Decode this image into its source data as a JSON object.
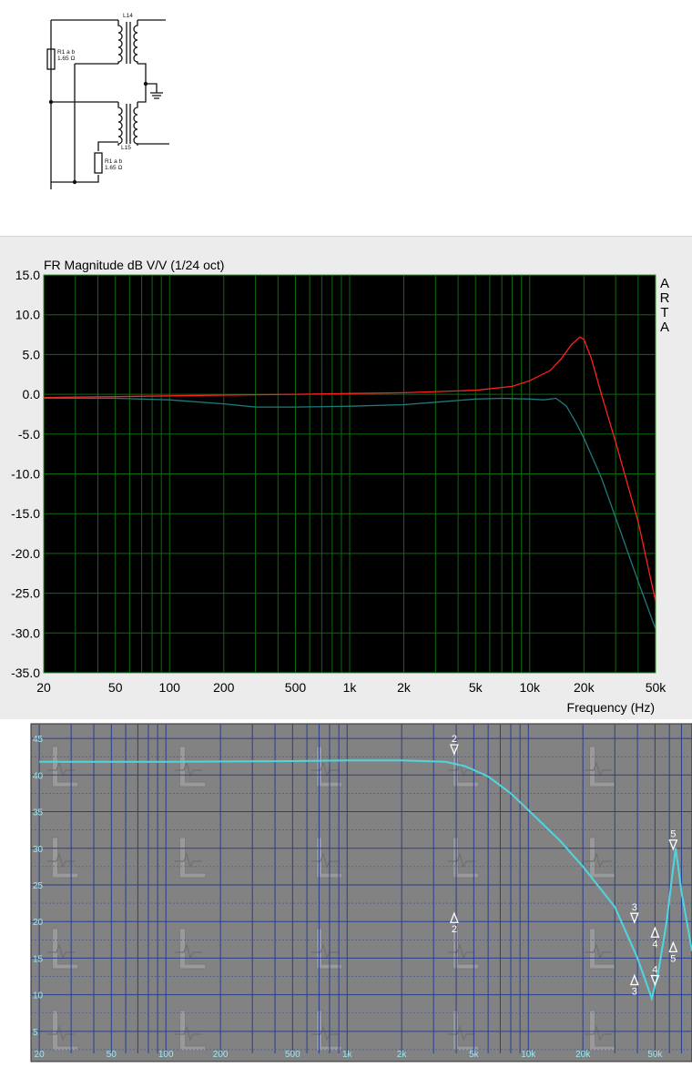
{
  "schematic": {
    "inductor_top": "L14",
    "inductor_bottom": "L15",
    "resistor_top_name": "R1 a b",
    "resistor_top_value": "1.65 Ω",
    "resistor_bottom_name": "R1 a b",
    "resistor_bottom_value": "1.65 Ω"
  },
  "chart_data": [
    {
      "type": "line",
      "title": "FR Magnitude dB V/V (1/24 oct)",
      "xlabel": "Frequency (Hz)",
      "ylabel": "",
      "x_scale": "log",
      "xlim": [
        20,
        50000
      ],
      "ylim": [
        -35,
        15
      ],
      "x_ticks": [
        20,
        50,
        100,
        200,
        500,
        1000,
        2000,
        5000,
        10000,
        20000,
        50000
      ],
      "x_tick_labels": [
        "20",
        "50",
        "100",
        "200",
        "500",
        "1k",
        "2k",
        "5k",
        "10k",
        "20k",
        "50k"
      ],
      "y_ticks": [
        15,
        10,
        5,
        0,
        -5,
        -10,
        -15,
        -20,
        -25,
        -30,
        -35
      ],
      "y_tick_labels": [
        "15.0",
        "10.0",
        "5.0",
        "0.0",
        "-5.0",
        "-10.0",
        "-15.0",
        "-20.0",
        "-25.0",
        "-30.0",
        "-35.0"
      ],
      "watermark": "ARTA",
      "grid": true,
      "colors": {
        "background": "#000000",
        "grid": "#0e6a0e",
        "series_1": "#ff2020",
        "series_2": "#1f7a7a"
      },
      "series": [
        {
          "x": [
            20,
            30,
            50,
            100,
            200,
            500,
            1000,
            2000,
            5000,
            8000,
            10000,
            13000,
            15000,
            17000,
            19000,
            20000,
            22000,
            25000,
            30000,
            40000,
            50000
          ],
          "y": [
            -0.4,
            -0.35,
            -0.3,
            -0.2,
            -0.1,
            0.0,
            0.1,
            0.2,
            0.5,
            1.0,
            1.7,
            3.0,
            4.5,
            6.2,
            7.2,
            6.9,
            4.5,
            0.0,
            -6.0,
            -16.0,
            -26.0
          ]
        },
        {
          "x": [
            20,
            50,
            100,
            200,
            300,
            500,
            1000,
            2000,
            3000,
            5000,
            7000,
            10000,
            12000,
            14000,
            16000,
            18000,
            20000,
            25000,
            30000,
            40000,
            50000
          ],
          "y": [
            -0.5,
            -0.5,
            -0.7,
            -1.2,
            -1.6,
            -1.6,
            -1.5,
            -1.3,
            -1.0,
            -0.6,
            -0.5,
            -0.6,
            -0.7,
            -0.5,
            -1.5,
            -3.5,
            -5.5,
            -10.5,
            -15.5,
            -23.5,
            -29.5
          ]
        }
      ]
    },
    {
      "type": "line",
      "title": "",
      "xlabel": "",
      "ylabel": "",
      "x_scale": "log",
      "xlim": [
        18,
        80000
      ],
      "ylim": [
        2,
        47
      ],
      "x_tick_labels": [
        "20",
        "50",
        "100",
        "200",
        "500",
        "1k",
        "2k",
        "5k",
        "10k",
        "20k",
        "50k"
      ],
      "x_ticks": [
        20,
        50,
        100,
        200,
        500,
        1000,
        2000,
        5000,
        10000,
        20000,
        50000
      ],
      "y_ticks": [
        5,
        10,
        15,
        20,
        25,
        30,
        35,
        40,
        45
      ],
      "y_tick_labels": [
        "5",
        "10",
        "15",
        "20",
        "25",
        "30",
        "35",
        "40",
        "45"
      ],
      "grid": true,
      "colors": {
        "background": "#828282",
        "grid": "#2a3f8c",
        "trace": "#4ed6e0",
        "labels": "#9ee8f0",
        "marker": "#ffffff"
      },
      "series": [
        {
          "x": [
            20,
            100,
            500,
            1000,
            2000,
            3500,
            4500,
            6000,
            8000,
            10000,
            15000,
            20000,
            30000,
            40000,
            48000,
            52000,
            58000,
            62000,
            65000,
            70000,
            80000
          ],
          "y": [
            41.8,
            41.8,
            41.9,
            42.0,
            42.0,
            41.8,
            41.2,
            39.8,
            37.5,
            35.2,
            31.0,
            27.5,
            22.0,
            15.0,
            9.5,
            13.0,
            20.0,
            26.0,
            30.0,
            24.0,
            16.0
          ]
        }
      ],
      "markers": [
        {
          "label": "2",
          "x": 3900,
          "y": 43.5,
          "dir": "down"
        },
        {
          "label": "2",
          "x": 3900,
          "y": 20.5,
          "dir": "up"
        },
        {
          "label": "3",
          "x": 38500,
          "y": 20.5,
          "dir": "down"
        },
        {
          "label": "3",
          "x": 38500,
          "y": 12.0,
          "dir": "up"
        },
        {
          "label": "4",
          "x": 50000,
          "y": 18.5,
          "dir": "up"
        },
        {
          "label": "4",
          "x": 50000,
          "y": 12.0,
          "dir": "down"
        },
        {
          "label": "5",
          "x": 63000,
          "y": 30.5,
          "dir": "down"
        },
        {
          "label": "5",
          "x": 63000,
          "y": 16.5,
          "dir": "up"
        }
      ]
    }
  ]
}
